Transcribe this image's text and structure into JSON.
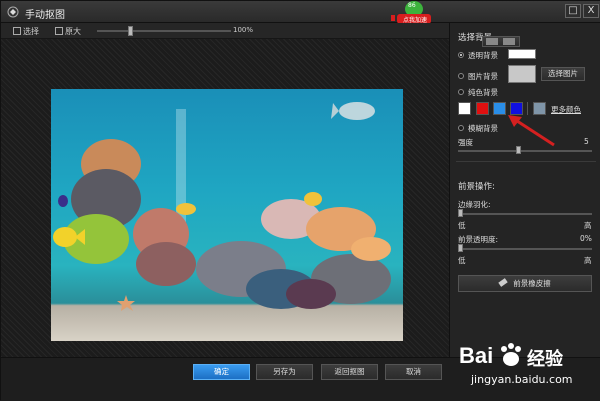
{
  "window": {
    "title": "手动抠图",
    "min_label": "□",
    "close_label": "X"
  },
  "promo": {
    "number": "86",
    "text": "点我加速"
  },
  "toolbar": {
    "select_label": "选择",
    "enlarge_label": "原大",
    "zoom_percent": "100%",
    "zoom_level": 0.25
  },
  "panel": {
    "select_bg_label": "选择背景",
    "transparent_bg_label": "透明背景",
    "picture_bg_label": "图片背景",
    "choose_picture_label": "选择图片",
    "solid_bg_label": "纯色背景",
    "more_colors_label": "更多颜色",
    "blur_bg_label": "模糊背景",
    "strength_label": "强度",
    "strength_value": "5",
    "strength_level": 0.5,
    "fg_ops_label": "前景操作:",
    "edge_feather_label": "边缘羽化:",
    "low_label": "低",
    "high_label": "高",
    "fg_opacity_label": "前景透明度:",
    "fg_opacity_value": "0%",
    "eraser_label": "前景橡皮擦",
    "swatches": [
      "#ffffff",
      "#e01010",
      "#2a8ee8",
      "#1010e0",
      "#7f95a8"
    ]
  },
  "footer": {
    "ok_label": "确定",
    "save_as_label": "另存为",
    "return_label": "返回抠图",
    "cancel_label": "取消"
  },
  "watermark": {
    "brand": "Bai",
    "brand_suffix": "经验",
    "url": "jingyan.baidu.com"
  },
  "colors": {
    "accent": "#2a8ee8",
    "arrow": "#d42020"
  }
}
